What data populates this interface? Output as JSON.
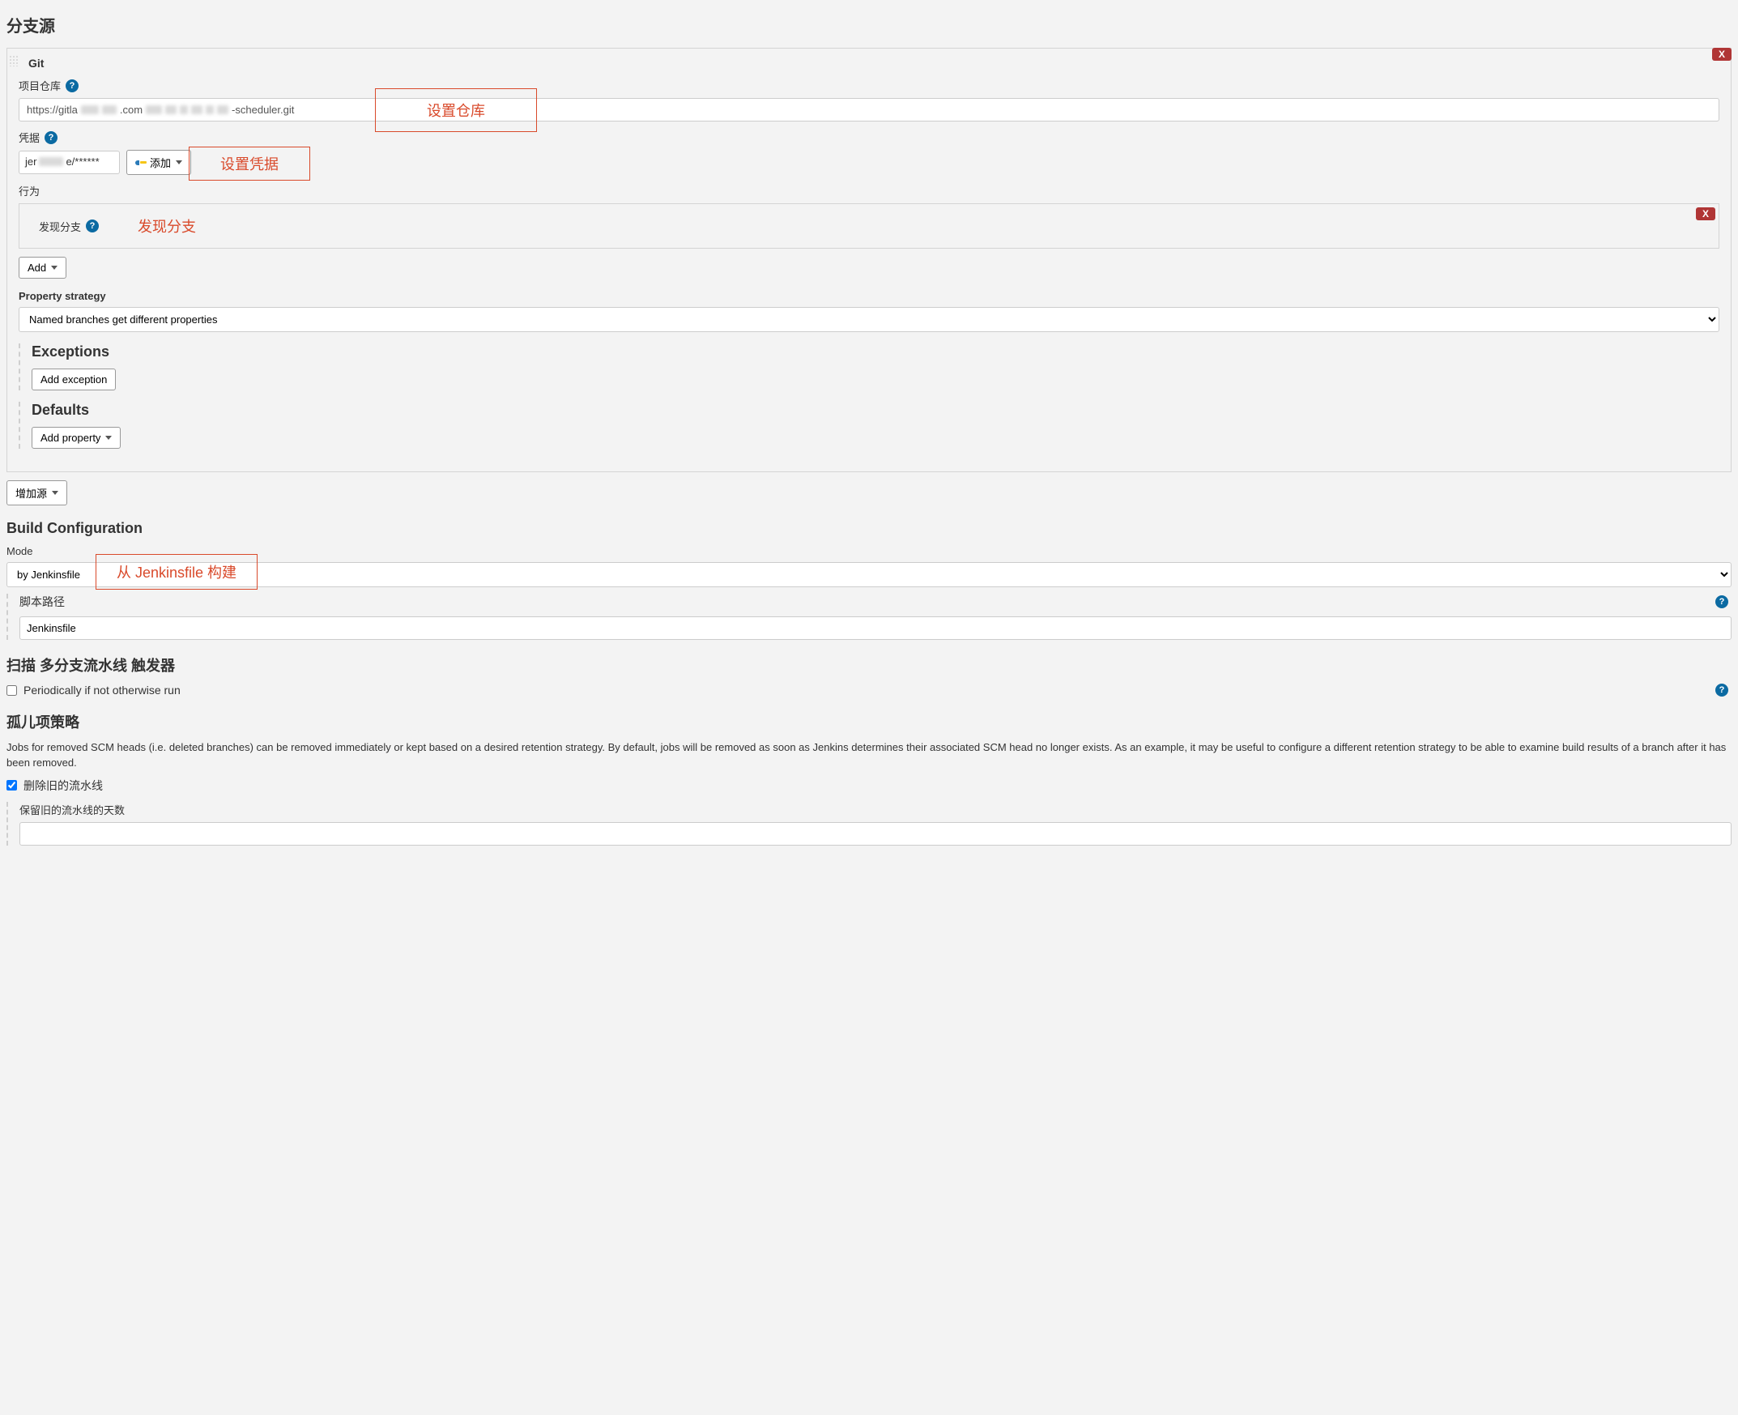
{
  "section": {
    "branch_sources": "分支源",
    "git": "Git",
    "project_repo": "项目仓库",
    "credentials": "凭据",
    "behaviour": "行为",
    "discover_branches": "发现分支",
    "property_strategy": "Property strategy",
    "exceptions": "Exceptions",
    "defaults": "Defaults",
    "build_config": "Build Configuration",
    "mode": "Mode",
    "script_path": "脚本路径",
    "scan_triggers": "扫描 多分支流水线 触发器",
    "orphan_strategy": "孤儿项策略"
  },
  "repo": {
    "prefix": "https://gitla",
    "mid1": ".com",
    "suffix": "-scheduler.git"
  },
  "credentials_select": {
    "prefix": "jer",
    "suffix": "e/******"
  },
  "buttons": {
    "add_cred": "添加",
    "add": "Add",
    "add_exception": "Add exception",
    "add_property": "Add property",
    "add_source": "增加源",
    "delete": "X"
  },
  "selects": {
    "property_strategy": "Named branches get different properties",
    "mode": "by Jenkinsfile"
  },
  "inputs": {
    "script_path": "Jenkinsfile"
  },
  "checks": {
    "periodic": "Periodically if not otherwise run",
    "discard_old": "删除旧的流水线",
    "days_keep": "保留旧的流水线的天数"
  },
  "orphan_desc": "Jobs for removed SCM heads (i.e. deleted branches) can be removed immediately or kept based on a desired retention strategy. By default, jobs will be removed as soon as Jenkins determines their associated SCM head no longer exists. As an example, it may be useful to configure a different retention strategy to be able to examine build results of a branch after it has been removed.",
  "annotations": {
    "set_repo": "设置仓库",
    "set_cred": "设置凭据",
    "discover": "发现分支",
    "from_jenkinsfile": "从 Jenkinsfile 构建"
  },
  "help": "?"
}
